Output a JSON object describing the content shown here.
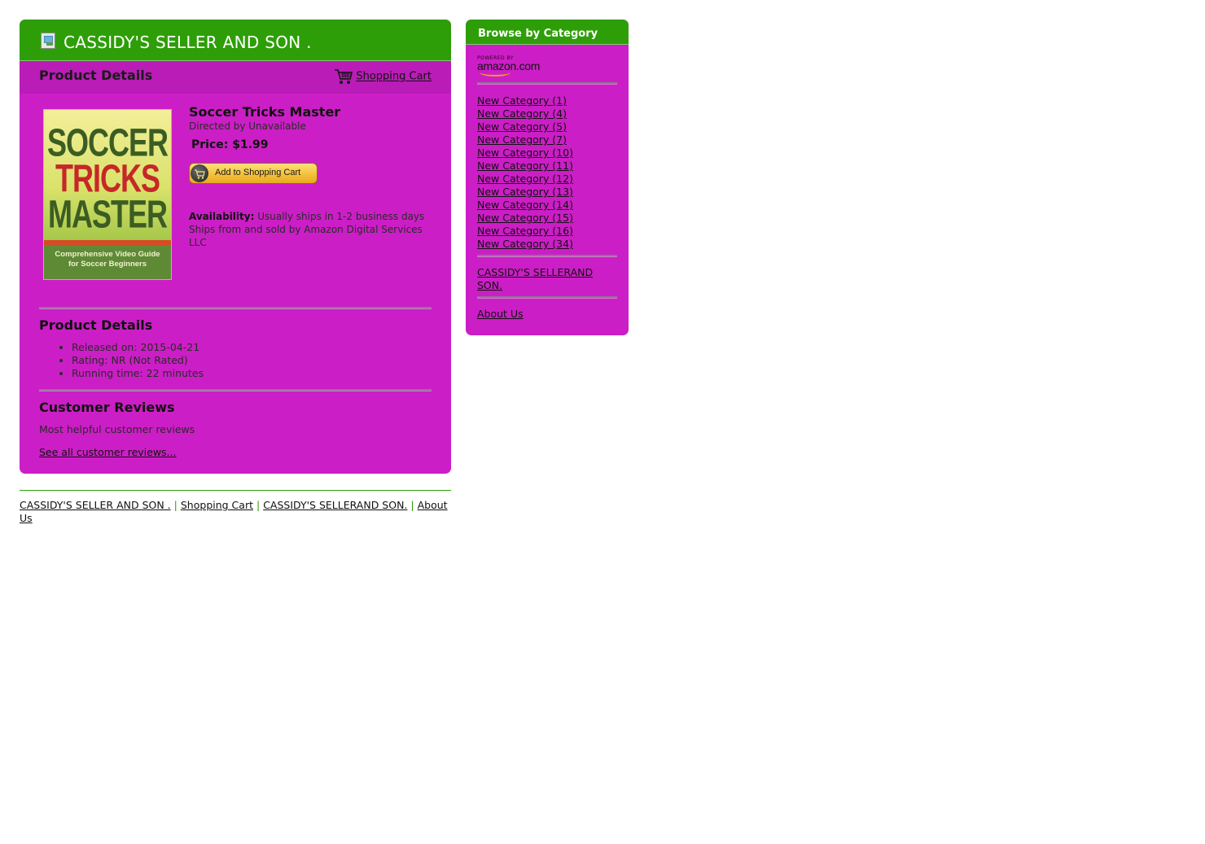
{
  "store": {
    "title": "CASSIDY'S SELLER AND SON ."
  },
  "subheader": {
    "title": "Product Details",
    "cart_link": "Shopping Cart"
  },
  "product": {
    "title": "Soccer Tricks Master",
    "directed_by": "Directed by Unavailable",
    "price": "Price: $1.99",
    "add_to_cart": "Add to Shopping Cart",
    "availability_label": "Availability:",
    "availability_text": "Usually ships in 1-2 business days Ships from and sold by Amazon Digital Services LLC",
    "cover": {
      "words": [
        "SOCCER",
        "TRICKS",
        "MASTER"
      ],
      "subtitle_line1": "Comprehensive Video Guide",
      "subtitle_line2": "for Soccer Beginners",
      "colors": {
        "green": "#3b5d23",
        "red": "#c62828",
        "background": "#5e8a36"
      }
    }
  },
  "details": {
    "heading": "Product Details",
    "items": [
      "Released on: 2015-04-21",
      "Rating: NR (Not Rated)",
      "Running time: 22 minutes"
    ]
  },
  "reviews": {
    "heading": "Customer Reviews",
    "subheading": "Most helpful customer reviews",
    "see_all": "See all customer reviews..."
  },
  "sidebar": {
    "title": "Browse by Category",
    "amazon_small": "POWERED BY",
    "amazon_main": "amazon.com",
    "categories": [
      "New Category (1)",
      "New Category (4)",
      "New Category (5)",
      "New Category (7)",
      "New Category (10)",
      "New Category (11)",
      "New Category (12)",
      "New Category (13)",
      "New Category (14)",
      "New Category (15)",
      "New Category (16)",
      "New Category (34)"
    ],
    "store_link": "CASSIDY'S SELLERAND SON.",
    "about_link": "About Us"
  },
  "footer": {
    "links": [
      "CASSIDY'S SELLER AND SON .",
      "Shopping Cart",
      "CASSIDY'S SELLERAND SON.",
      "About Us"
    ],
    "separator": "|"
  },
  "colors": {
    "panel_magenta": "#cc1ec6",
    "header_green": "#2e9e08",
    "subheader_magenta": "#ba1cb7"
  }
}
